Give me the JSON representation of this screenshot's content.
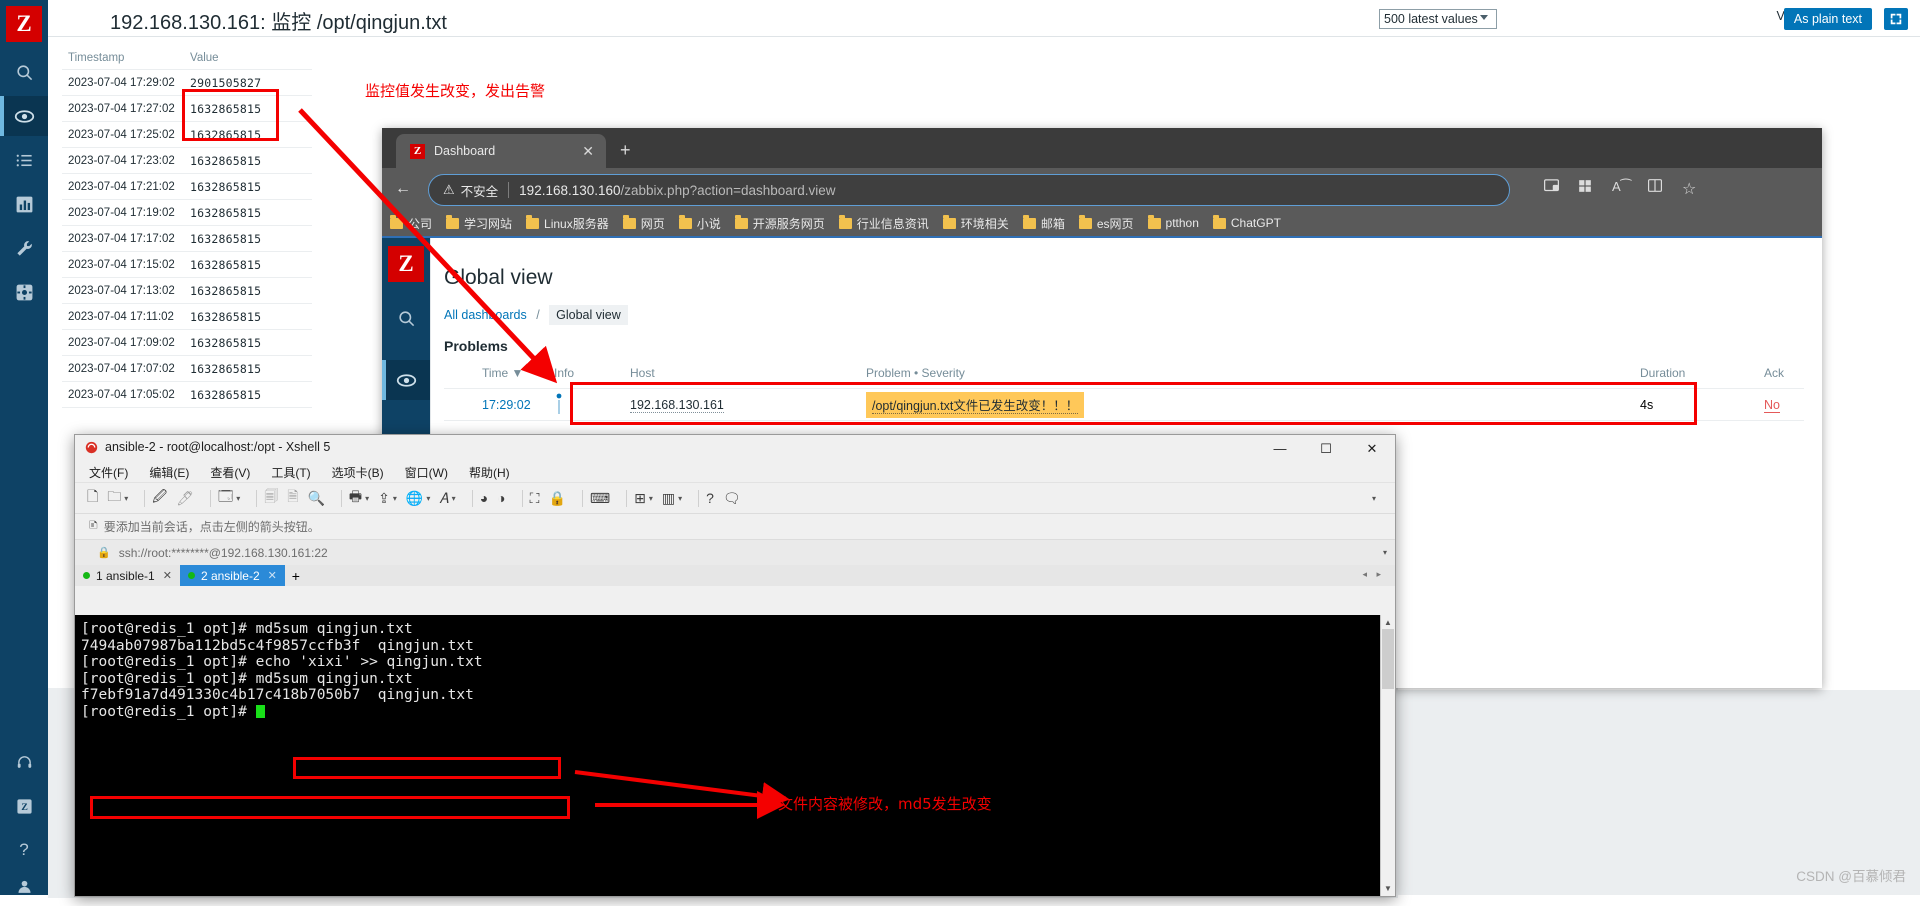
{
  "zabbix_page": {
    "title": "192.168.130.161: 监控 /opt/qingjun.txt",
    "logo": "Z",
    "view_as_label": "View as",
    "view_as_value": "500 latest values",
    "plain_text_button": "As plain text",
    "kiosk_icon": "⤢",
    "sidebar_icons": [
      {
        "name": "search-icon",
        "glyph": "⚲"
      },
      {
        "name": "monitoring-eye-icon",
        "glyph": "◉"
      },
      {
        "name": "inventory-list-icon",
        "glyph": "☰"
      },
      {
        "name": "reports-chart-icon",
        "glyph": "▦"
      },
      {
        "name": "configuration-wrench-icon",
        "glyph": "🔧"
      },
      {
        "name": "administration-gear-icon",
        "glyph": "✲"
      },
      {
        "name": "support-headset-icon",
        "glyph": "⌒"
      },
      {
        "name": "zabbix-integrations-icon",
        "glyph": "Z"
      },
      {
        "name": "help-icon",
        "glyph": "?"
      },
      {
        "name": "user-profile-icon",
        "glyph": "●"
      }
    ],
    "table": {
      "columns": [
        "Timestamp",
        "Value"
      ],
      "rows": [
        {
          "timestamp": "2023-07-04 17:29:02",
          "value": "2901505827"
        },
        {
          "timestamp": "2023-07-04 17:27:02",
          "value": "1632865815"
        },
        {
          "timestamp": "2023-07-04 17:25:02",
          "value": "1632865815"
        },
        {
          "timestamp": "2023-07-04 17:23:02",
          "value": "1632865815"
        },
        {
          "timestamp": "2023-07-04 17:21:02",
          "value": "1632865815"
        },
        {
          "timestamp": "2023-07-04 17:19:02",
          "value": "1632865815"
        },
        {
          "timestamp": "2023-07-04 17:17:02",
          "value": "1632865815"
        },
        {
          "timestamp": "2023-07-04 17:15:02",
          "value": "1632865815"
        },
        {
          "timestamp": "2023-07-04 17:13:02",
          "value": "1632865815"
        },
        {
          "timestamp": "2023-07-04 17:11:02",
          "value": "1632865815"
        },
        {
          "timestamp": "2023-07-04 17:09:02",
          "value": "1632865815"
        },
        {
          "timestamp": "2023-07-04 17:07:02",
          "value": "1632865815"
        },
        {
          "timestamp": "2023-07-04 17:05:02",
          "value": "1632865815"
        }
      ]
    }
  },
  "annotations": {
    "top_note": "监控值发生改变，发出告警",
    "bottom_note": "文件内容被修改，md5发生改变",
    "accent_color": "#f40000"
  },
  "browser": {
    "tab": {
      "favicon": "Z",
      "title": "Dashboard",
      "close": "✕"
    },
    "new_tab": "+",
    "nav": {
      "back": "←",
      "reload": "⟳",
      "home": "⌂"
    },
    "omnibox": {
      "warning_icon": "⚠",
      "warning_text": "不安全",
      "url_host": "192.168.130.160",
      "url_path": "/zabbix.php?action=dashboard.view"
    },
    "right_icons": [
      {
        "name": "cast-icon",
        "glyph": "🖵"
      },
      {
        "name": "collections-icon",
        "glyph": "⊞"
      },
      {
        "name": "read-aloud-icon",
        "glyph": "A⁀"
      },
      {
        "name": "split-screen-icon",
        "glyph": "◫"
      },
      {
        "name": "favorite-star-icon",
        "glyph": "☆"
      }
    ],
    "bookmarks": [
      "公司",
      "学习网站",
      "Linux服务器",
      "网页",
      "小说",
      "开源服务网页",
      "行业信息资讯",
      "环境相关",
      "邮箱",
      "es网页",
      "ptthon",
      "ChatGPT"
    ]
  },
  "dashboard": {
    "logo": "Z",
    "title": "Global view",
    "breadcrumb": {
      "all": "All dashboards",
      "sep": "/",
      "current": "Global view"
    },
    "widget_title": "Problems",
    "columns": [
      "Time ▼",
      "Info",
      "Host",
      "Problem • Severity",
      "Duration",
      "Ack"
    ],
    "rows": [
      {
        "time": "17:29:02",
        "info": "",
        "host": "192.168.130.161",
        "problem": "/opt/qingjun.txt文件已发生改变！！！",
        "duration": "4s",
        "ack": "No"
      }
    ]
  },
  "xshell": {
    "window_title": "ansible-2 - root@localhost:/opt - Xshell 5",
    "window_buttons": {
      "minimize": "—",
      "maximize": "☐",
      "close": "✕"
    },
    "menus": [
      "文件(F)",
      "编辑(E)",
      "查看(V)",
      "工具(T)",
      "选项卡(B)",
      "窗口(W)",
      "帮助(H)"
    ],
    "add_session_hint": "要添加当前会话，点击左侧的箭头按钮。",
    "connection_url": "ssh://root:********@192.168.130.161:22",
    "tabs": [
      {
        "label": "1 ansible-1",
        "selected": false
      },
      {
        "label": "2 ansible-2",
        "selected": true
      }
    ],
    "new_tab": "+",
    "terminal_lines": [
      "[root@redis_1 opt]# md5sum qingjun.txt",
      "7494ab07987ba112bd5c4f9857ccfb3f  qingjun.txt",
      "[root@redis_1 opt]# echo 'xixi' >> qingjun.txt",
      "[root@redis_1 opt]# md5sum qingjun.txt",
      "f7ebf91a7d491330c4b17c418b7050b7  qingjun.txt",
      "[root@redis_1 opt]# "
    ]
  },
  "watermark": "CSDN @百慕倾君"
}
